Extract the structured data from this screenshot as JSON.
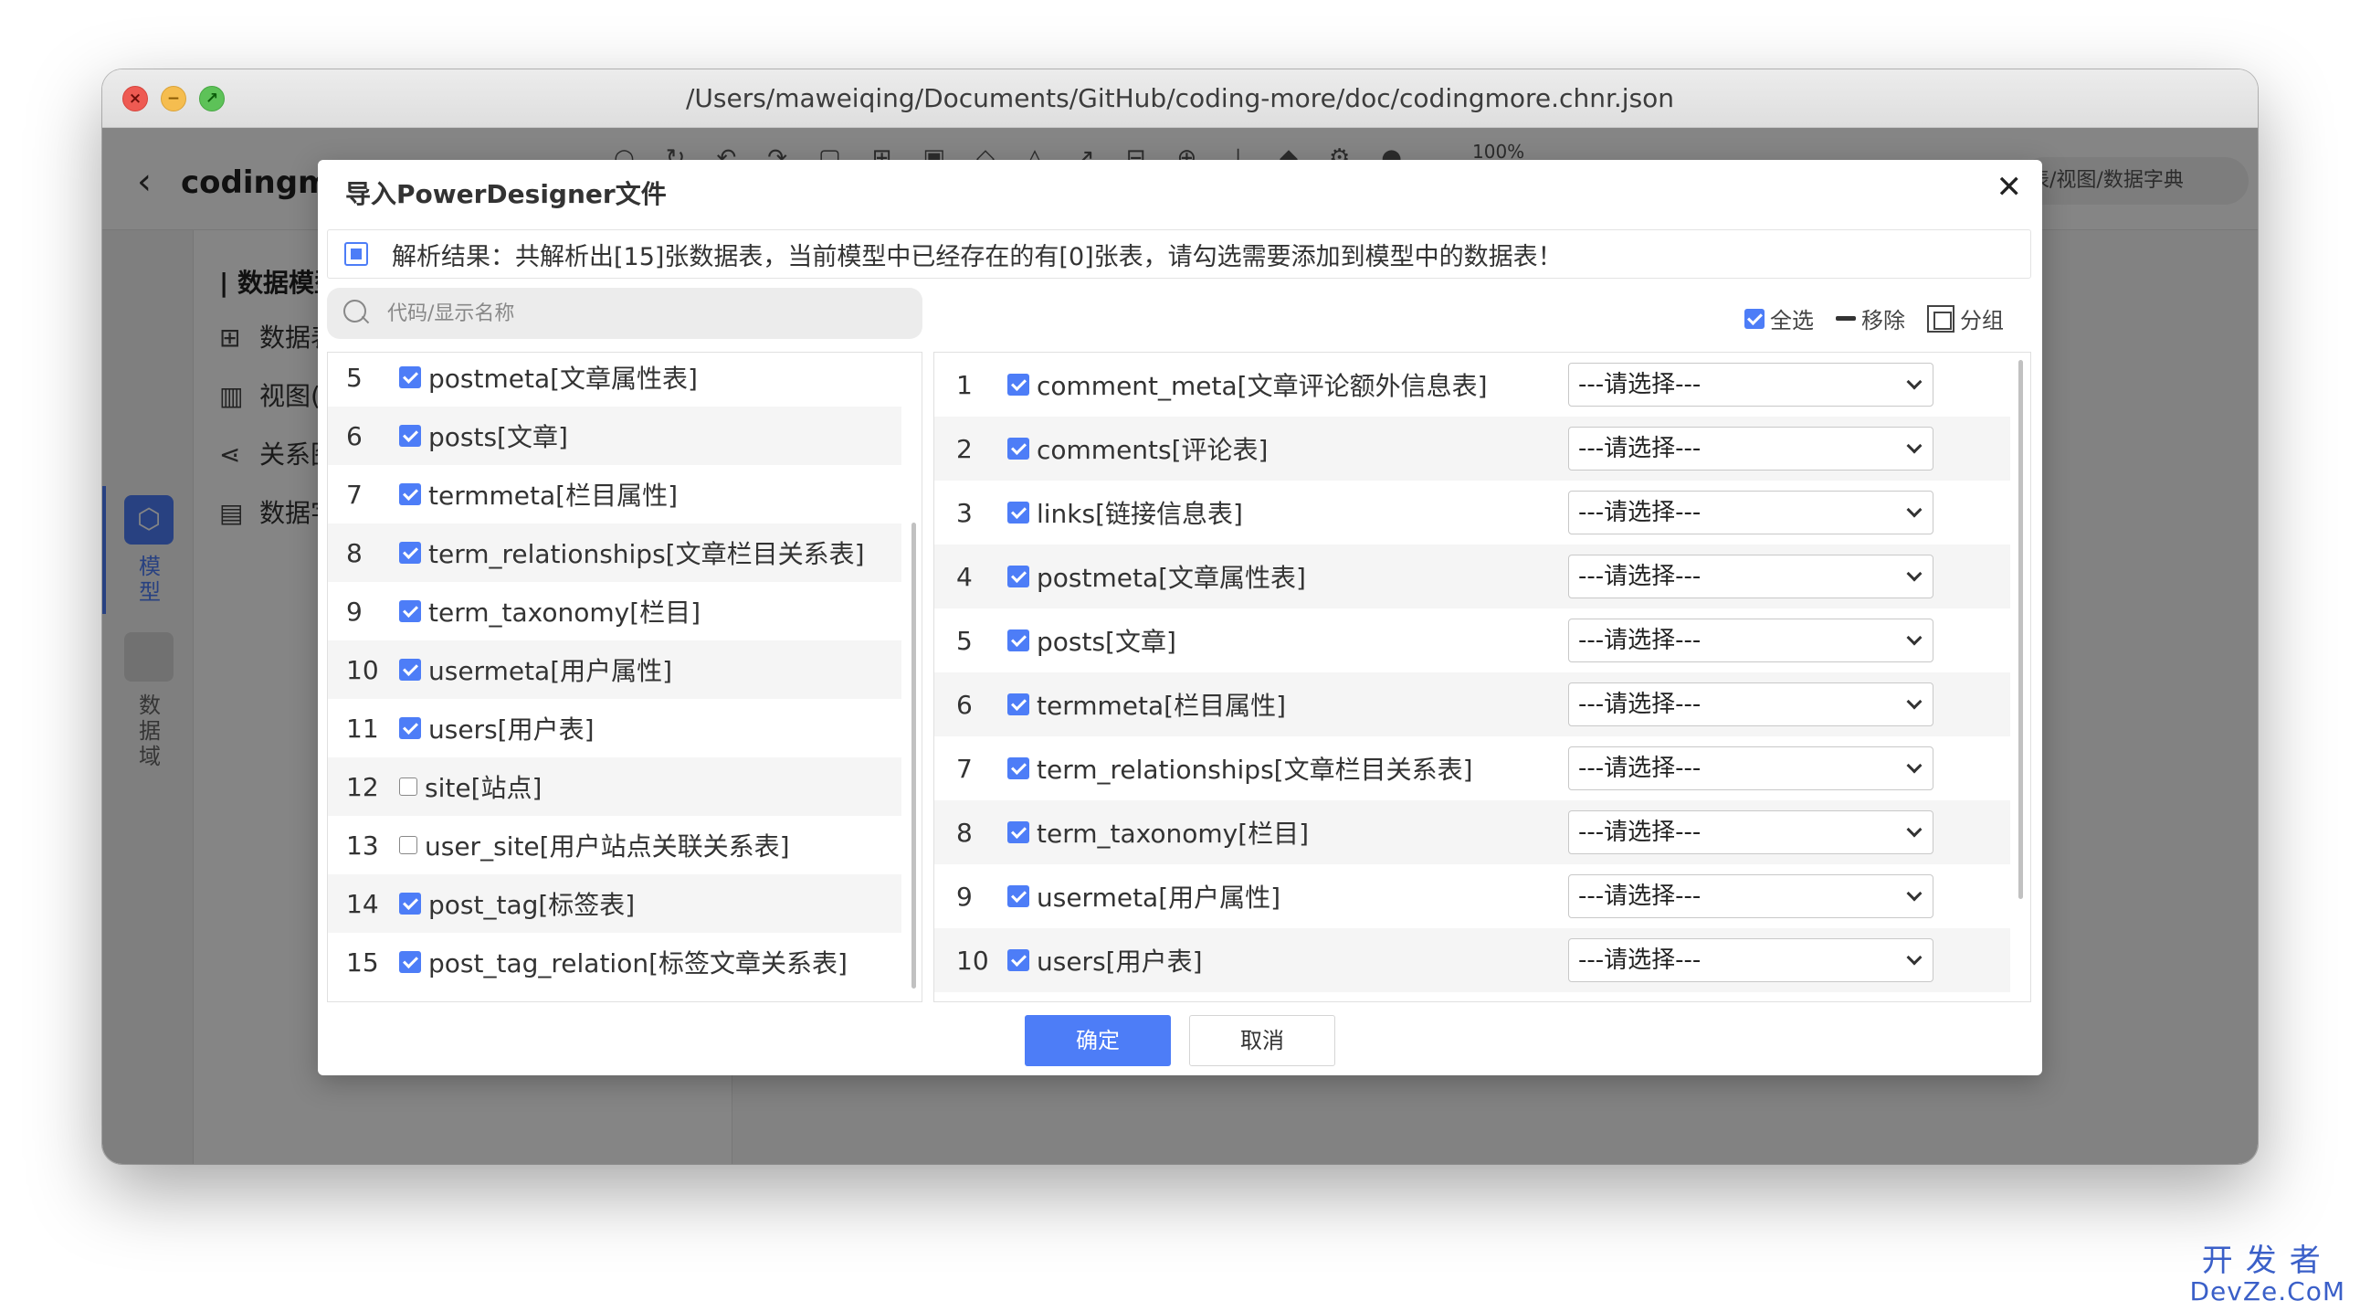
{
  "window": {
    "title": "/Users/maweiqing/Documents/GitHub/coding-more/doc/codingmore.chnr.json"
  },
  "app": {
    "project_name": "codingmo",
    "search_hint": "表/视图/数据字典",
    "zoom": "100%",
    "rail": {
      "model_label": "模型",
      "domain_label": "数据域"
    },
    "tree": {
      "title": "数据模型",
      "items": [
        "数据表",
        "视图(",
        "关系图",
        "数据字"
      ]
    }
  },
  "dialog": {
    "title": "导入PowerDesigner文件",
    "notice": "解析结果：共解析出[15]张数据表，当前模型中已经存在的有[0]张表，请勾选需要添加到模型中的数据表！",
    "search_placeholder": "代码/显示名称",
    "actions": {
      "select_all": "全选",
      "remove": "移除",
      "group": "分组"
    },
    "left_rows": [
      {
        "num": "5",
        "name": "postmeta[文章属性表]",
        "checked": true
      },
      {
        "num": "6",
        "name": "posts[文章]",
        "checked": true
      },
      {
        "num": "7",
        "name": "termmeta[栏目属性]",
        "checked": true
      },
      {
        "num": "8",
        "name": "term_relationships[文章栏目关系表]",
        "checked": true
      },
      {
        "num": "9",
        "name": "term_taxonomy[栏目]",
        "checked": true
      },
      {
        "num": "10",
        "name": "usermeta[用户属性]",
        "checked": true
      },
      {
        "num": "11",
        "name": "users[用户表]",
        "checked": true
      },
      {
        "num": "12",
        "name": "site[站点]",
        "checked": false
      },
      {
        "num": "13",
        "name": "user_site[用户站点关联关系表]",
        "checked": false
      },
      {
        "num": "14",
        "name": "post_tag[标签表]",
        "checked": true
      },
      {
        "num": "15",
        "name": "post_tag_relation[标签文章关系表]",
        "checked": true
      }
    ],
    "right_rows": [
      {
        "num": "1",
        "name": "comment_meta[文章评论额外信息表]",
        "select": "---请选择---"
      },
      {
        "num": "2",
        "name": "comments[评论表]",
        "select": "---请选择---"
      },
      {
        "num": "3",
        "name": "links[链接信息表]",
        "select": "---请选择---"
      },
      {
        "num": "4",
        "name": "postmeta[文章属性表]",
        "select": "---请选择---"
      },
      {
        "num": "5",
        "name": "posts[文章]",
        "select": "---请选择---"
      },
      {
        "num": "6",
        "name": "termmeta[栏目属性]",
        "select": "---请选择---"
      },
      {
        "num": "7",
        "name": "term_relationships[文章栏目关系表]",
        "select": "---请选择---"
      },
      {
        "num": "8",
        "name": "term_taxonomy[栏目]",
        "select": "---请选择---"
      },
      {
        "num": "9",
        "name": "usermeta[用户属性]",
        "select": "---请选择---"
      },
      {
        "num": "10",
        "name": "users[用户表]",
        "select": "---请选择---"
      }
    ],
    "buttons": {
      "ok": "确定",
      "cancel": "取消"
    }
  },
  "watermark": {
    "top": "开发者",
    "bottom": "DevZe.CoM"
  },
  "colors": {
    "accent": "#4d7df7",
    "overlay": "rgba(0,0,0,0.48)"
  }
}
